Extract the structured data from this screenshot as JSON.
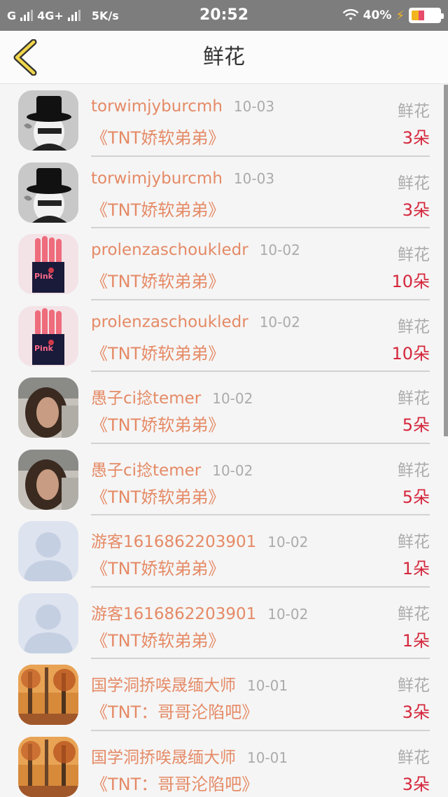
{
  "status_bar": {
    "carrier": "G",
    "network": "4G+",
    "speed": "5K/s",
    "time": "20:52",
    "battery_percent": "40%",
    "battery_level": 0.4
  },
  "header": {
    "title": "鲜花",
    "back_icon": "chevron-left-icon"
  },
  "colors": {
    "accent": "#e58a66",
    "count_red": "#d5273c",
    "muted": "#ababab"
  },
  "records": [
    {
      "user": "torwimjyburcmh",
      "date": "10-03",
      "gift": "鲜花",
      "book": "《TNT娇软弟弟》",
      "count": "3朵",
      "avatar": "top-hat-portrait"
    },
    {
      "user": "torwimjyburcmh",
      "date": "10-03",
      "gift": "鲜花",
      "book": "《TNT娇软弟弟》",
      "count": "3朵",
      "avatar": "top-hat-portrait"
    },
    {
      "user": "prolenzaschoukledr",
      "date": "10-02",
      "gift": "鲜花",
      "book": "《TNT娇软弟弟》",
      "count": "10朵",
      "avatar": "pink-box"
    },
    {
      "user": "prolenzaschoukledr",
      "date": "10-02",
      "gift": "鲜花",
      "book": "《TNT娇软弟弟》",
      "count": "10朵",
      "avatar": "pink-box"
    },
    {
      "user": "愚子ci捻temer",
      "date": "10-02",
      "gift": "鲜花",
      "book": "《TNT娇软弟弟》",
      "count": "5朵",
      "avatar": "curly-hair-portrait"
    },
    {
      "user": "愚子ci捻temer",
      "date": "10-02",
      "gift": "鲜花",
      "book": "《TNT娇软弟弟》",
      "count": "5朵",
      "avatar": "curly-hair-portrait"
    },
    {
      "user": "游客1616862203901",
      "date": "10-02",
      "gift": "鲜花",
      "book": "《TNT娇软弟弟》",
      "count": "1朵",
      "avatar": "default-person"
    },
    {
      "user": "游客1616862203901",
      "date": "10-02",
      "gift": "鲜花",
      "book": "《TNT娇软弟弟》",
      "count": "1朵",
      "avatar": "default-person"
    },
    {
      "user": "国学洞挢唉晟缅大师",
      "date": "10-01",
      "gift": "鲜花",
      "book": "《TNT：哥哥沦陷吧》",
      "count": "3朵",
      "avatar": "autumn-forest"
    },
    {
      "user": "国学洞挢唉晟缅大师",
      "date": "10-01",
      "gift": "鲜花",
      "book": "《TNT：哥哥沦陷吧》",
      "count": "3朵",
      "avatar": "autumn-forest"
    }
  ]
}
